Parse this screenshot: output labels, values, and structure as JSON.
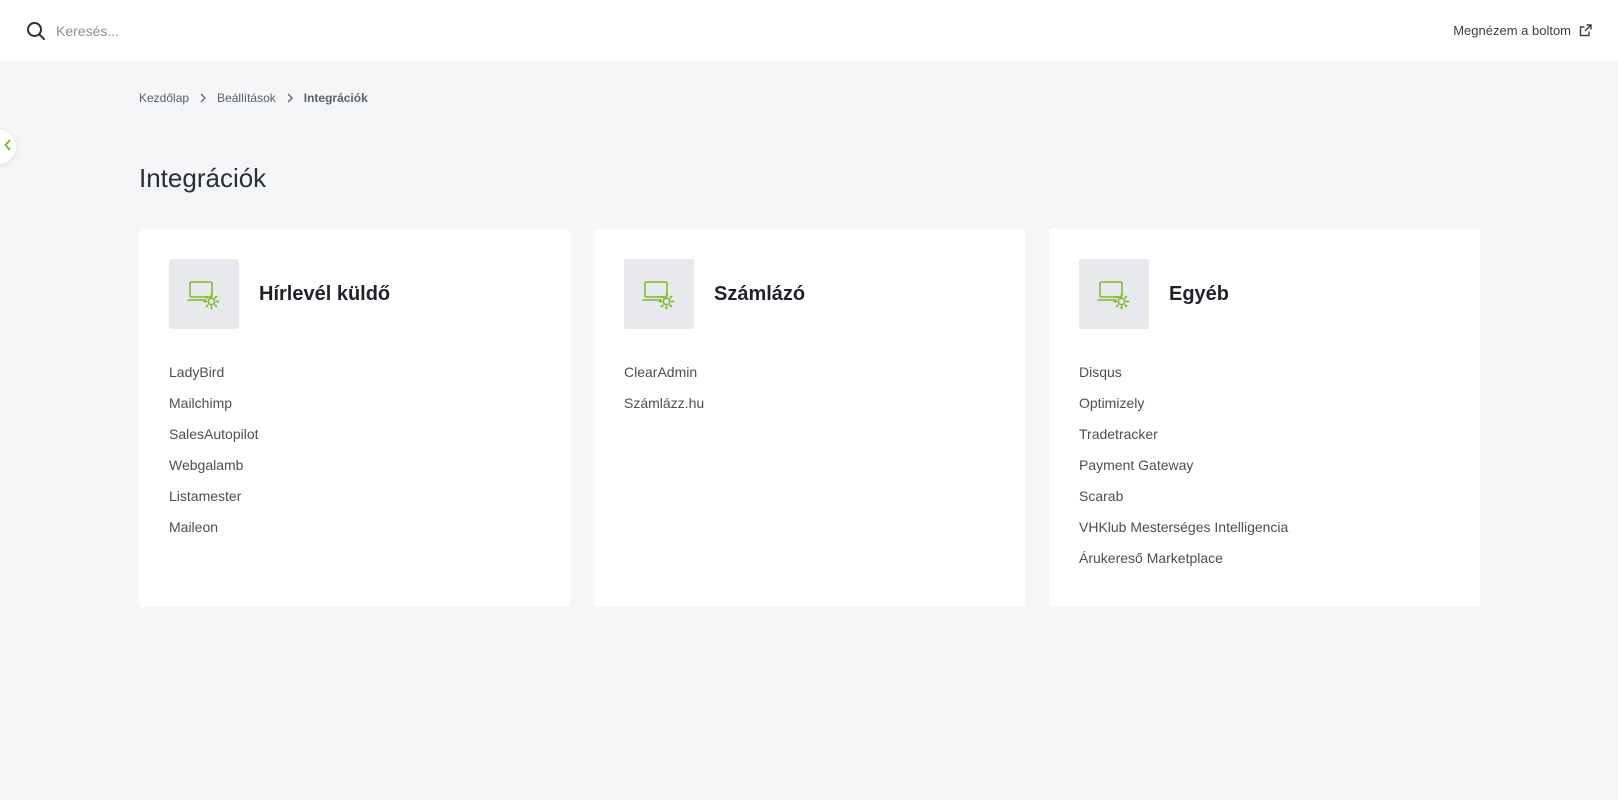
{
  "topbar": {
    "search_placeholder": "Keresés...",
    "preview_label": "Megnézem a boltom"
  },
  "breadcrumb": {
    "items": [
      "Kezdőlap",
      "Beállítások"
    ],
    "current": "Integrációk"
  },
  "page": {
    "title": "Integrációk"
  },
  "colors": {
    "accent": "#7ab929",
    "background": "#f5f6f8",
    "card": "#ffffff"
  },
  "cards": [
    {
      "title": "Hírlevél küldő",
      "icon": "monitor-gear-icon",
      "items": [
        "LadyBird",
        "Mailchimp",
        "SalesAutopilot",
        "Webgalamb",
        "Listamester",
        "Maileon"
      ]
    },
    {
      "title": "Számlázó",
      "icon": "monitor-gear-icon",
      "items": [
        "ClearAdmin",
        "Számlázz.hu"
      ]
    },
    {
      "title": "Egyéb",
      "icon": "monitor-gear-icon",
      "items": [
        "Disqus",
        "Optimizely",
        "Tradetracker",
        "Payment Gateway",
        "Scarab",
        "VHKlub Mesterséges Intelligencia",
        "Árukereső Marketplace"
      ]
    }
  ]
}
